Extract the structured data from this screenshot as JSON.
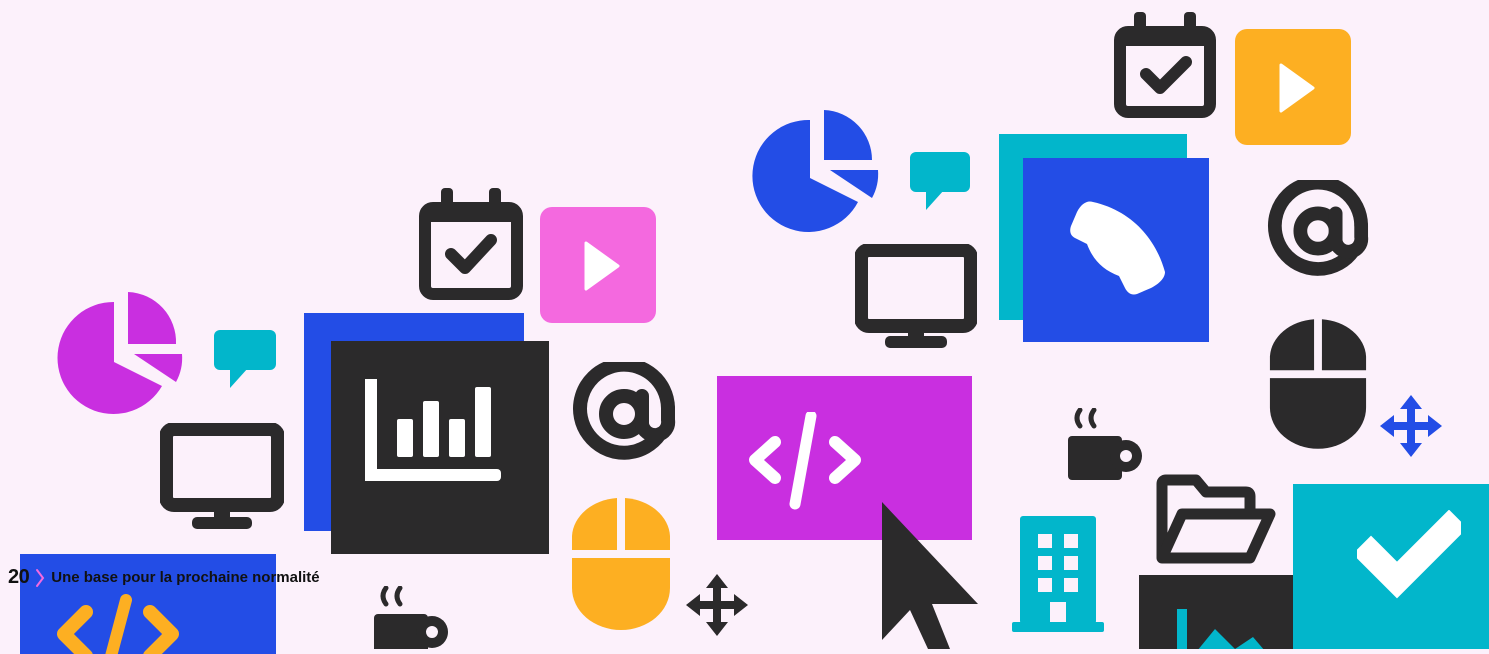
{
  "footer": {
    "page_number": "20",
    "title": "Une base pour la prochaine normalité"
  },
  "colors": {
    "background": "#fcf1fb",
    "blue": "#234de6",
    "dark": "#2b2a2b",
    "magenta": "#c92fe0",
    "pink": "#f469df",
    "cyan": "#02b6cb",
    "yellow": "#fdaf22"
  },
  "icons": [
    "pie-chart-icon",
    "chat-bubble-icon",
    "monitor-icon",
    "calendar-check-icon",
    "play-icon",
    "bar-chart-icon",
    "at-sign-icon",
    "mouse-icon",
    "move-arrows-icon",
    "coffee-cup-icon",
    "code-icon",
    "cursor-arrow-icon",
    "phone-icon",
    "building-icon",
    "folder-open-icon",
    "checkmark-icon",
    "line-chart-icon"
  ]
}
